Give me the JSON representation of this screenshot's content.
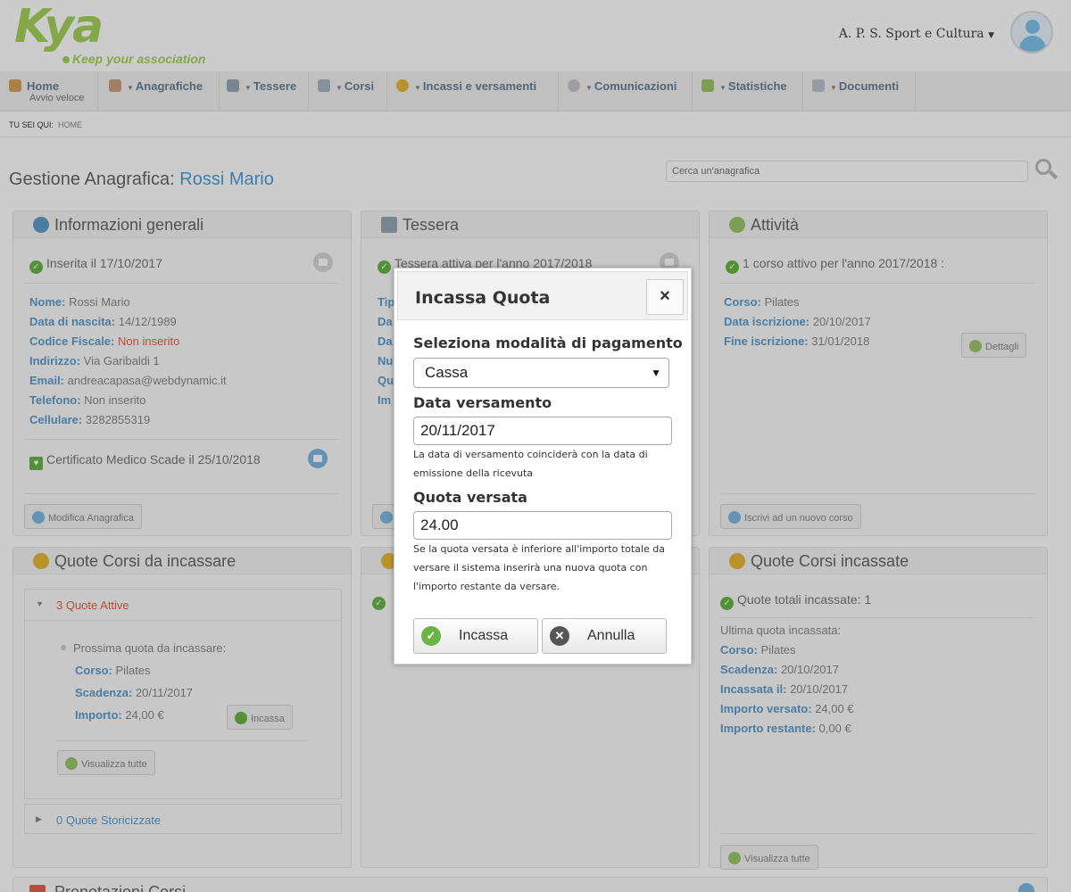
{
  "header": {
    "logo_text": "Kya",
    "logo_tagline": "Keep your association",
    "association": "A. P. S. Sport e Cultura"
  },
  "nav": {
    "items": [
      {
        "label": "Home",
        "sub": "Avvio veloce"
      },
      {
        "label": "Anagrafiche"
      },
      {
        "label": "Tessere"
      },
      {
        "label": "Corsi"
      },
      {
        "label": "Incassi e versamenti"
      },
      {
        "label": "Comunicazioni"
      },
      {
        "label": "Statistiche"
      },
      {
        "label": "Documenti"
      }
    ]
  },
  "breadcrumb": {
    "prefix": "TU SEI QUI:",
    "current": "HOME"
  },
  "page": {
    "title_prefix": "Gestione Anagrafica:",
    "title_name": "Rossi Mario",
    "search_placeholder": "Cerca un'anagrafica"
  },
  "info_panel": {
    "title": "Informazioni generali",
    "status": "Inserita il 17/10/2017",
    "fields": [
      {
        "label": "Nome:",
        "value": "Rossi Mario"
      },
      {
        "label": "Data di nascita:",
        "value": "14/12/1989"
      },
      {
        "label": "Codice Fiscale:",
        "value": "Non inserito"
      },
      {
        "label": "Indirizzo:",
        "value": "Via Garibaldi 1"
      },
      {
        "label": "Email:",
        "value": "andreacapasa@webdynamic.it"
      },
      {
        "label": "Telefono:",
        "value": "Non inserito"
      },
      {
        "label": "Cellulare:",
        "value": "3282855319"
      }
    ],
    "certificate": "Certificato Medico Scade il 25/10/2018",
    "edit_button": "Modifica Anagrafica"
  },
  "card_panel": {
    "title": "Tessera",
    "status": "Tessera attiva per l'anno 2017/2018",
    "field_prefixes": [
      "Tip",
      "Da",
      "Da",
      "Nu",
      "Qu",
      "Im"
    ]
  },
  "activity_panel": {
    "title": "Attività",
    "status": "1 corso attivo per l'anno 2017/2018 :",
    "fields": [
      {
        "label": "Corso:",
        "value": "Pilates"
      },
      {
        "label": "Data iscrizione:",
        "value": "20/10/2017"
      },
      {
        "label": "Fine iscrizione:",
        "value": "31/01/2018"
      }
    ],
    "details_button": "Dettagli",
    "enroll_button": "Iscrivi ad un nuovo corso"
  },
  "dues_panel": {
    "title": "Quote Corsi da incassare",
    "active_label": "3 Quote Attive",
    "next_label": "Prossima quota da incassare:",
    "fields": [
      {
        "label": "Corso:",
        "value": "Pilates"
      },
      {
        "label": "Scadenza:",
        "value": "20/11/2017"
      },
      {
        "label": "Importo:",
        "value": "24,00 €"
      }
    ],
    "collect_button": "Incassa",
    "view_all_button": "Visualizza tutte",
    "archived_label": "0 Quote Storicizzate"
  },
  "collected_panel": {
    "title": "Quote Corsi incassate",
    "status": "Quote totali incassate: 1",
    "last_label": "Ultima quota incassata:",
    "fields": [
      {
        "label": "Corso:",
        "value": "Pilates"
      },
      {
        "label": "Scadenza:",
        "value": "20/10/2017"
      },
      {
        "label": "Incassata il:",
        "value": "20/10/2017"
      },
      {
        "label": "Importo versato:",
        "value": "24,00 €"
      },
      {
        "label": "Importo restante:",
        "value": "0,00 €"
      }
    ],
    "view_all_button": "Visualizza tutte"
  },
  "bottom_panel": {
    "title": "Prenotazioni Corsi"
  },
  "modal": {
    "title": "Incassa Quota",
    "close": "×",
    "payment_label": "Seleziona modalità di pagamento",
    "payment_value": "Cassa",
    "date_label": "Data versamento",
    "date_value": "20/11/2017",
    "date_help": "La data di versamento coinciderà con la data di emissione della ricevuta",
    "amount_label": "Quota versata",
    "amount_value": "24.00",
    "amount_help": "Se la quota versata è inferiore all'importo totale da versare il sistema inserirà una nuova quota con l'importo restante da versare.",
    "confirm_button": "Incassa",
    "cancel_button": "Annulla"
  },
  "colors": {
    "brand_green": "#a6d25c",
    "link_blue": "#5e9ccb",
    "alert_red": "#e8614a",
    "ok_green": "#6ab446"
  }
}
